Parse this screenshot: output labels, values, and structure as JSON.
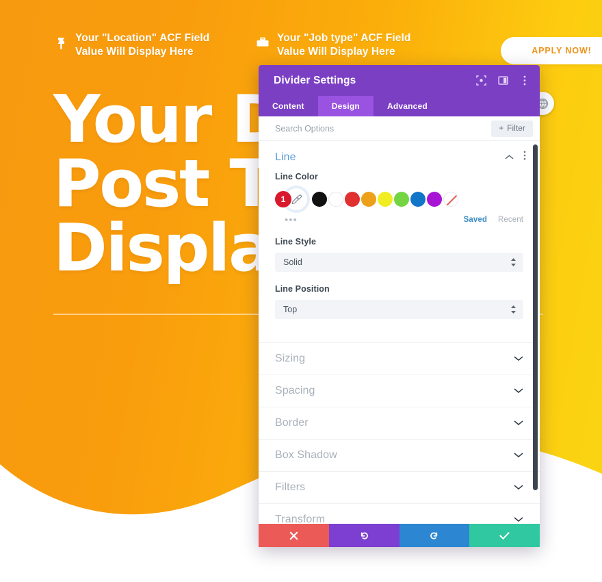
{
  "hero": {
    "meta": [
      {
        "icon": "map-pin-icon",
        "text": "Your \"Location\" ACF Field\nValue Will Display Here"
      },
      {
        "icon": "briefcase-icon",
        "text": "Your \"Job type\" ACF Field\nValue Will Display Here"
      }
    ],
    "apply_label": "APPLY NOW!",
    "headline_lines": [
      "Your Dynamic",
      "Post Title Will",
      "Display Here"
    ],
    "colors": {
      "gradient_start": "#f79a10",
      "gradient_end": "#fad513",
      "text": "#ffffff"
    }
  },
  "modal": {
    "title": "Divider Settings",
    "header_icons": [
      "target-icon",
      "panel-layout-icon",
      "kebab-menu-icon"
    ],
    "tabs": [
      {
        "label": "Content",
        "active": false
      },
      {
        "label": "Design",
        "active": true
      },
      {
        "label": "Advanced",
        "active": false
      }
    ],
    "search": {
      "placeholder": "Search Options",
      "value": ""
    },
    "filter_label": "Filter",
    "open_section": {
      "title": "Line",
      "collapse_icon": "chevron-up-icon",
      "menu_icon": "kebab-menu-icon",
      "line_color": {
        "label": "Line Color",
        "badge": "1",
        "picker_icon": "eyedropper-icon",
        "swatches": [
          {
            "name": "black",
            "hex": "#111111"
          },
          {
            "name": "white",
            "hex": "#ffffff"
          },
          {
            "name": "red",
            "hex": "#e03030"
          },
          {
            "name": "orange",
            "hex": "#eda01a"
          },
          {
            "name": "yellow",
            "hex": "#f0ee22"
          },
          {
            "name": "green",
            "hex": "#74d442"
          },
          {
            "name": "blue",
            "hex": "#1275c8"
          },
          {
            "name": "purple",
            "hex": "#a814d6"
          },
          {
            "name": "none",
            "hex": "#ffffff"
          }
        ],
        "more_dots": "•••",
        "saved_label": "Saved",
        "recent_label": "Recent"
      },
      "line_style": {
        "label": "Line Style",
        "value": "Solid"
      },
      "line_position": {
        "label": "Line Position",
        "value": "Top"
      }
    },
    "collapsed_sections": [
      {
        "label": "Sizing"
      },
      {
        "label": "Spacing"
      },
      {
        "label": "Border"
      },
      {
        "label": "Box Shadow"
      },
      {
        "label": "Filters"
      },
      {
        "label": "Transform"
      }
    ],
    "actions": [
      {
        "name": "cancel",
        "icon": "close-icon",
        "color": "#eb5a57"
      },
      {
        "name": "undo",
        "icon": "undo-icon",
        "color": "#7c3fd1"
      },
      {
        "name": "redo",
        "icon": "redo-icon",
        "color": "#2c86d1"
      },
      {
        "name": "save",
        "icon": "checkmark-icon",
        "color": "#30c8a0"
      }
    ],
    "accent_colors": {
      "header": "#7b3fc4",
      "active_tab": "#9a52e0",
      "section_title": "#5b9dd9"
    }
  }
}
